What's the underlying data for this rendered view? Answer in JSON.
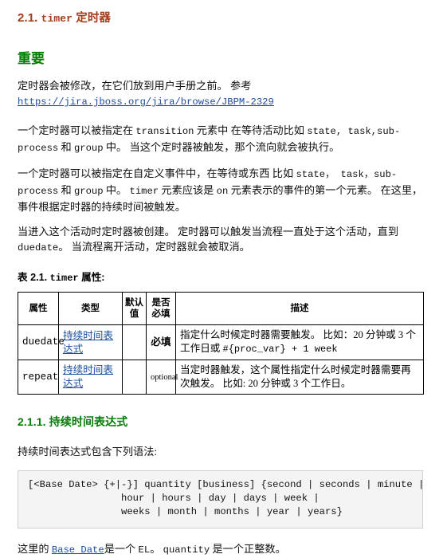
{
  "colors": {
    "section_heading": "#a33c18",
    "admonition_heading": "#008000",
    "subsection_heading": "#0a7a0a",
    "link": "#1a4fa0",
    "code_background": "#f4f4f4",
    "code_border": "#cfcfcf",
    "table_border": "#000000",
    "body_text": "#111111"
  },
  "section": {
    "number": "2.1.",
    "mono_term": "timer",
    "title": "定时器"
  },
  "admonition": {
    "title": "重要",
    "paragraph": "定时器会被修改，在它们放到用户手册之前。 参考",
    "link_text": "https://jira.jboss.org/jira/browse/JBPM-2329"
  },
  "paragraphs": [
    {
      "id": "p-transition",
      "runs": [
        {
          "type": "text",
          "text": "一个定时器可以被指定在 "
        },
        {
          "type": "mono",
          "text": "transition"
        },
        {
          "type": "text",
          "text": " 元素中 在等待活动比如 "
        },
        {
          "type": "mono",
          "text": "state, task,sub-process"
        },
        {
          "type": "text",
          "text": " 和 "
        },
        {
          "type": "mono",
          "text": "group"
        },
        {
          "type": "text",
          "text": " 中。 当这个定时器被触发，那个流向就会被执行。"
        }
      ]
    },
    {
      "id": "p-custom-event",
      "runs": [
        {
          "type": "text",
          "text": "一个定时器可以被指定在自定义事件中，在等待或东西 比如 "
        },
        {
          "type": "mono",
          "text": "state， task，sub-process"
        },
        {
          "type": "text",
          "text": " 和 "
        },
        {
          "type": "mono",
          "text": "group"
        },
        {
          "type": "text",
          "text": " 中。 "
        },
        {
          "type": "mono",
          "text": "timer"
        },
        {
          "type": "text",
          "text": " 元素应该是 "
        },
        {
          "type": "mono",
          "text": "on"
        },
        {
          "type": "text",
          "text": " 元素表示的事件的第一个元素。 在这里，事件根据定时器的持续时间被触发。"
        }
      ]
    },
    {
      "id": "p-activity-lifecycle",
      "runs": [
        {
          "type": "text",
          "text": "当进入这个活动时定时器被创建。 定时器可以触发当流程一直处于这个活动，直到 "
        },
        {
          "type": "mono",
          "text": "duedate"
        },
        {
          "type": "text",
          "text": "。 当流程离开活动，定时器就会被取消。"
        }
      ]
    }
  ],
  "table": {
    "caption_prefix": "表 2.1. ",
    "caption_mono": "timer",
    "caption_suffix": " 属性:",
    "headers": [
      "属性",
      "类型",
      "默认值",
      "是否必填",
      "描述"
    ],
    "rows": [
      {
        "attribute": "duedate",
        "type_link": "持续时间表达式",
        "default": "",
        "required": "必填",
        "required_style": "bold",
        "description_runs": [
          {
            "type": "text",
            "text": "指定什么时候定时器需要触发。 比如：20 分钟或 3 个工作日或 "
          },
          {
            "type": "mono",
            "text": "#{proc_var} + 1 week"
          }
        ]
      },
      {
        "attribute": "repeat",
        "type_link": "持续时间表达式",
        "default": "",
        "required": "optional",
        "required_style": "normal",
        "description_runs": [
          {
            "type": "text",
            "text": "当定时器触发，这个属性指定什么时候定时器需要再次触发。 比如: 20 分钟或 3 个工作日。"
          }
        ]
      }
    ]
  },
  "subsection": {
    "number": "2.1.1.",
    "title": "持续时间表达式",
    "intro": "持续时间表达式包含下列语法:"
  },
  "code_block": {
    "text": "[<Base Date> {+|-}] quantity [business] {second | seconds | minute | minutes |\n                hour | hours | day | days | week |\n                weeks | month | months | year | years}"
  },
  "closing": {
    "runs": [
      {
        "type": "text",
        "text": "这里的 "
      },
      {
        "type": "link-mono",
        "text": "Base Date"
      },
      {
        "type": "text",
        "text": "是一个 "
      },
      {
        "type": "mono",
        "text": "EL"
      },
      {
        "type": "text",
        "text": "。 "
      },
      {
        "type": "mono",
        "text": "quantity"
      },
      {
        "type": "text",
        "text": " 是一个正整数。"
      }
    ]
  }
}
